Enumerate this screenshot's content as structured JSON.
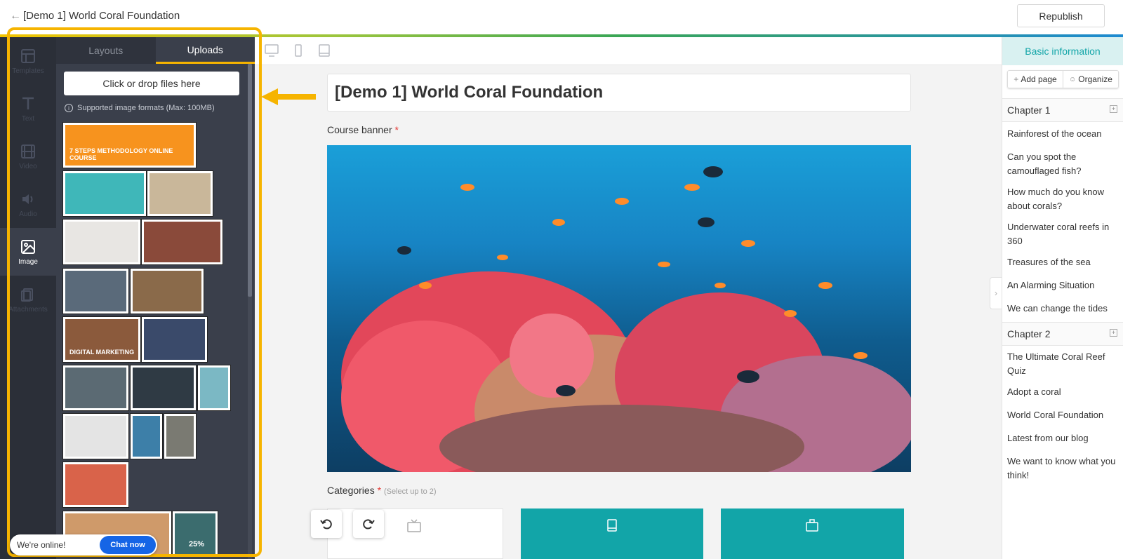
{
  "header": {
    "title": "[Demo 1] World Coral Foundation",
    "republish_label": "Republish"
  },
  "rail": {
    "items": [
      {
        "label": "Templates",
        "icon": "layout-icon"
      },
      {
        "label": "Text",
        "icon": "text-icon"
      },
      {
        "label": "Video",
        "icon": "film-icon"
      },
      {
        "label": "Audio",
        "icon": "speaker-icon"
      },
      {
        "label": "Image",
        "icon": "image-icon",
        "active": true
      },
      {
        "label": "Attachments",
        "icon": "attachment-icon"
      }
    ]
  },
  "panel": {
    "tabs": [
      {
        "label": "Layouts",
        "active": false
      },
      {
        "label": "Uploads",
        "active": true
      }
    ],
    "upload_label": "Click or drop files here",
    "formats_note": "Supported image formats (Max: 100MB)",
    "thumbnails": [
      {
        "caption": "7 STEPS METHODOLOGY ONLINE COURSE",
        "color": "#f7931e"
      },
      {
        "caption": "",
        "color": "#3fb7b9"
      },
      {
        "caption": "",
        "color": "#c9b79a"
      },
      {
        "caption": "",
        "color": "#e8e6e3"
      },
      {
        "caption": "",
        "color": "#8a4a3a"
      },
      {
        "caption": "",
        "color": "#5a6a7a"
      },
      {
        "caption": "",
        "color": "#8a6a4a"
      },
      {
        "caption": "DIGITAL MARKETING",
        "color": "#8b5a3c"
      },
      {
        "caption": "",
        "color": "#3a4a6a"
      },
      {
        "caption": "",
        "color": "#5b6a73"
      },
      {
        "caption": "",
        "color": "#2f3a44"
      },
      {
        "caption": "",
        "color": "#7bb8c4"
      },
      {
        "caption": "",
        "color": "#e4e4e4"
      },
      {
        "caption": "",
        "color": "#3d7fa8"
      },
      {
        "caption": "",
        "color": "#7a7a72"
      },
      {
        "caption": "",
        "color": "#d9634a"
      },
      {
        "caption": "",
        "color": "#cf9a6a"
      },
      {
        "caption": "25%",
        "color": "#3b6c6e"
      }
    ]
  },
  "chat": {
    "status": "We're online!",
    "button": "Chat now"
  },
  "editor": {
    "course_title": "[Demo 1] World Coral Foundation",
    "banner_label": "Course banner",
    "required_mark": "*",
    "categories_label": "Categories",
    "categories_hint": "(Select up to 2)"
  },
  "sidebar": {
    "basic_info": "Basic information",
    "add_page": "Add page",
    "organize": "Organize",
    "chapters": [
      {
        "title": "Chapter 1",
        "pages": [
          "Rainforest of the ocean",
          "Can you spot the camouflaged fish?",
          "How much do you know about corals?",
          "Underwater coral reefs in 360",
          "Treasures of the sea",
          "An Alarming Situation",
          "We can change the tides"
        ]
      },
      {
        "title": "Chapter 2",
        "pages": [
          "The Ultimate Coral Reef Quiz",
          "Adopt a coral",
          "World Coral Foundation",
          "Latest from our blog",
          "We want to know what you think!"
        ]
      }
    ]
  },
  "colors": {
    "accent_teal": "#12a5a8",
    "highlight_yellow": "#f6b400",
    "chat_blue": "#1565e6"
  }
}
